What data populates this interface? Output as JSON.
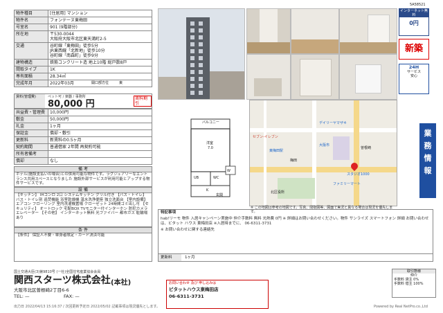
{
  "code": "5A58521",
  "spec_rows": [
    {
      "k": "物件種目",
      "v": "[住居用] マンション"
    },
    {
      "k": "物件名",
      "v": "フォンテーヌ東梅田"
    },
    {
      "k": "号室名",
      "v": "901 (9階部分)"
    },
    {
      "k": "所在地",
      "v": "〒530-0044\n大阪府大阪市北区東天満町2-5"
    },
    {
      "k": "交通",
      "v": "谷町線「東梅田」徒歩5分\nJR東西線「北新地」徒歩10分\n谷町線「南森町」徒歩9分"
    },
    {
      "k": "建物構造",
      "v": "鉄筋コンクリート造 地上10階 総戸数8戸"
    },
    {
      "k": "間取タイプ",
      "v": "1K"
    },
    {
      "k": "専有面積",
      "v": "28.34㎡"
    },
    {
      "k": "完成年月",
      "v": "2022年03月"
    }
  ],
  "exposure_label": "開口部方位",
  "exposure_value": "東",
  "rent_key": "賃料(管理費)",
  "rent_value": "80,000 円",
  "rent_tags": "ペット可 / 楽器 / 事務所",
  "rent_badge": "賃料割引",
  "money_rows": [
    {
      "k": "共益費・管理費",
      "v": "10,000円"
    },
    {
      "k": "敷金",
      "v": "50,000円"
    },
    {
      "k": "礼金",
      "v": "1ヶ月"
    },
    {
      "k": "保証金",
      "v": "償却・敷引"
    },
    {
      "k": "更新料",
      "v": "新賃料の0.5ヶ月"
    },
    {
      "k": "契約期間",
      "v": "普通借家 2年間 再契約可能"
    },
    {
      "k": "所有者備考",
      "v": ""
    },
    {
      "k": "償却",
      "v": "なし"
    }
  ],
  "sec_bikou_title": "備 考",
  "sec_bikou_body": "ホテル(施設支払いの場合)との併用可能な物件です。ラグジュアリーなエントランス共用スペースとなりました 施設外部サービスが利用可能とアップする物件サービスです。",
  "sec_setsubi_title": "設 備",
  "sec_setsubi_body": "【キッチン】 IHコンロ 2口 システムキッチン グリル付き 【バス・トイレ】 バス・トイレ別 追焚機能 浴室乾燥機 温水洗浄便座 独立洗面台 【室内設備】 エアコン フローリング 室内洗濯機置場 クローゼット 24時間ゴミ出し可 【セキュリティ】 オートロック 宅配BOX TVモニター付インターホン 防犯カメラ エレベーター 【その他】 インターネット無料 光ファイバー 都市ガス 駐輪場あり",
  "sec_jouken_title": "条 件",
  "sec_jouken_body": "【条件】 保証人不要・単身者限定・カード決済可能",
  "floor": {
    "balcony": "バルコニー",
    "room": "洋室",
    "room_size": "7.0",
    "ub": "UB",
    "wc": "WC",
    "wm": "W",
    "kitchen": "K",
    "entrance": "玄関"
  },
  "map": {
    "station1": "大阪市",
    "station2": "東梅田駅",
    "label1": "ファミリーマート",
    "label2": "梅田",
    "label3": "スタジオ1000",
    "label4": "デイリーヤマザキ",
    "label5": "曽根崎",
    "label6": "セブン-イレブン",
    "label7": "北区役所",
    "caption": "※ この地図は参考の地図です。写真、間取図等、図面で実況と異なる場合は現況を優先します。"
  },
  "badges": {
    "internet_top": "インターネット無料",
    "internet_val": "0円",
    "new": "新築",
    "service": "24H",
    "service2": "サービス",
    "service3": "安心"
  },
  "vertical_text": [
    "業",
    "務",
    "情",
    "報"
  ],
  "remarks": {
    "title": "特記事項",
    "body": "hab!リーモ 物件 入居キャンペーン実施中 仲介手数料 無料 光熱費 0円 ※ 詳細はお問い合わせください。物件 サンライズ スマートフォン 詳細 お問い合わせは、ビタット ハウス 東梅田店 ※入居時までに、 06-6311-3731",
    "notice": "※ お問い合わせに関する連絡先",
    "footer_k": "更新料",
    "footer_v": "1ヶ月"
  },
  "company": {
    "license": "国土交通大臣(3)第9810号 (一社)全国住宅産業協会会員",
    "name": "関西スターツ株式会社",
    "branch": "(本社)",
    "address": "大阪市北区曽根崎2丁目6-6",
    "tel": "TEL: —",
    "fax": "FAX: —"
  },
  "stamp_lines": [
    "お問い合わせ 及び 申し込みは",
    "ピタットハウス東梅田店",
    "06-6311-3731"
  ],
  "fee_title": "取引態様",
  "fee_sub": "仲介",
  "fee_rows": [
    "手数料 貸主 0%",
    "手数料 借主 100%"
  ],
  "footer_left": "出力日 2022/04/13 15:16:37 / 次回更新予定日 2022/05/02 記載事項は現況優先とします。",
  "footer_right": "Powered by Real NetPro.co.,Ltd"
}
